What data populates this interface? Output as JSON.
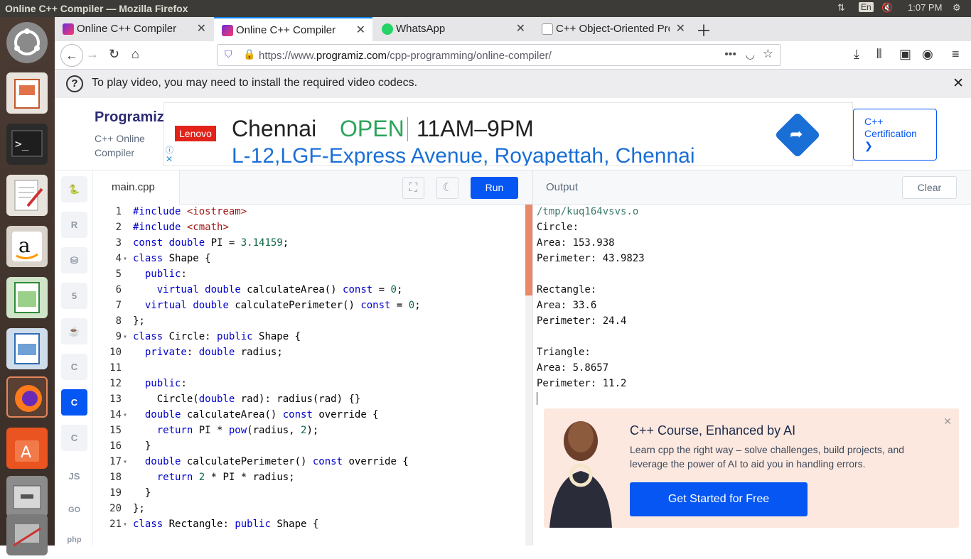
{
  "system": {
    "window_title": "Online C++ Compiler — Mozilla Firefox",
    "keyboard": "En",
    "clock": "1:07 PM"
  },
  "tabs": [
    {
      "label": "Online C++ Compiler",
      "icon": "programiz-icon"
    },
    {
      "label": "Online C++ Compiler",
      "icon": "programiz-icon"
    },
    {
      "label": "WhatsApp",
      "icon": "whatsapp-icon"
    },
    {
      "label": "C++ Object-Oriented Pro",
      "icon": "w3schools-icon"
    }
  ],
  "nav": {
    "url_prefix": "https://www.",
    "url_domain": "programiz.com",
    "url_path": "/cpp-programming/online-compiler/"
  },
  "notification": {
    "text": "To play video, you may need to install the required video codecs."
  },
  "site": {
    "logo": "Programiz",
    "tagline_1": "C++ Online",
    "tagline_2": "Compiler",
    "cert_line1": "C++",
    "cert_line2": "Certification",
    "cert_arrow": "❯"
  },
  "ad": {
    "brand": "Lenovo",
    "city": "Chennai",
    "status": "OPEN",
    "hours": "11AM–9PM",
    "address": "L-12,LGF-Express Avenue, Royapettah, Chennai"
  },
  "languages": [
    "python",
    "R",
    "sql",
    "html",
    "java",
    "C",
    "C++",
    "C#",
    "JS",
    "GO",
    "php"
  ],
  "editor": {
    "filename": "main.cpp",
    "run_label": "Run"
  },
  "code_lines": [
    {
      "n": "1",
      "fold": false,
      "html": "<span class=\"kw\">#include</span> <span class=\"str\">&lt;iostream&gt;</span>"
    },
    {
      "n": "2",
      "fold": false,
      "html": "<span class=\"kw\">#include</span> <span class=\"str\">&lt;cmath&gt;</span>"
    },
    {
      "n": "3",
      "fold": false,
      "html": "<span class=\"kw\">const</span> <span class=\"kt\">double</span> PI = <span class=\"num\">3.14159</span>;"
    },
    {
      "n": "4",
      "fold": true,
      "html": "<span class=\"kw\">class</span> Shape {"
    },
    {
      "n": "5",
      "fold": false,
      "html": "  <span class=\"kw\">public</span>:"
    },
    {
      "n": "6",
      "fold": false,
      "html": "    <span class=\"kw\">virtual</span> <span class=\"kt\">double</span> calculateArea() <span class=\"kw\">const</span> = <span class=\"num\">0</span>;"
    },
    {
      "n": "7",
      "fold": false,
      "html": "  <span class=\"kw\">virtual</span> <span class=\"kt\">double</span> calculatePerimeter() <span class=\"kw\">const</span> = <span class=\"num\">0</span>;"
    },
    {
      "n": "8",
      "fold": false,
      "html": "};"
    },
    {
      "n": "9",
      "fold": true,
      "html": "<span class=\"kw\">class</span> Circle: <span class=\"kw\">public</span> Shape {"
    },
    {
      "n": "10",
      "fold": false,
      "html": "  <span class=\"kw\">private</span>: <span class=\"kt\">double</span> radius;"
    },
    {
      "n": "11",
      "fold": false,
      "html": ""
    },
    {
      "n": "12",
      "fold": false,
      "html": "  <span class=\"kw\">public</span>:"
    },
    {
      "n": "13",
      "fold": false,
      "html": "    Circle(<span class=\"kt\">double</span> rad): radius(rad) {}"
    },
    {
      "n": "14",
      "fold": true,
      "html": "  <span class=\"kt\">double</span> calculateArea() <span class=\"kw\">const</span> override {"
    },
    {
      "n": "15",
      "fold": false,
      "html": "    <span class=\"kw\">return</span> PI * <span class=\"kw\">pow</span>(radius, <span class=\"num\">2</span>);"
    },
    {
      "n": "16",
      "fold": false,
      "html": "  }"
    },
    {
      "n": "17",
      "fold": true,
      "html": "  <span class=\"kt\">double</span> calculatePerimeter() <span class=\"kw\">const</span> override {"
    },
    {
      "n": "18",
      "fold": false,
      "html": "    <span class=\"kw\">return</span> <span class=\"num\">2</span> * PI * radius;"
    },
    {
      "n": "19",
      "fold": false,
      "html": "  }"
    },
    {
      "n": "20",
      "fold": false,
      "html": "};"
    },
    {
      "n": "21",
      "fold": true,
      "html": "<span class=\"kw\">class</span> Rectangle: <span class=\"kw\">public</span> Shape {"
    }
  ],
  "output": {
    "label": "Output",
    "clear_label": "Clear",
    "lines": [
      "/tmp/kuq164vsvs.o",
      "Circle:",
      "Area: 153.938",
      "Perimeter: 43.9823",
      "",
      "Rectangle:",
      "Area: 33.6",
      "Perimeter: 24.4",
      "",
      "Triangle:",
      "Area: 5.8657",
      "Perimeter: 11.2"
    ]
  },
  "promo": {
    "title": "C++ Course, Enhanced by AI",
    "body": "Learn cpp the right way – solve challenges, build projects, and leverage the power of AI to aid you in handling errors.",
    "cta": "Get Started for Free"
  },
  "colors": {
    "accent": "#0556f3",
    "open_green": "#2aa55a",
    "ad_blue": "#1a6fd6",
    "lenovo_red": "#e2231a"
  }
}
